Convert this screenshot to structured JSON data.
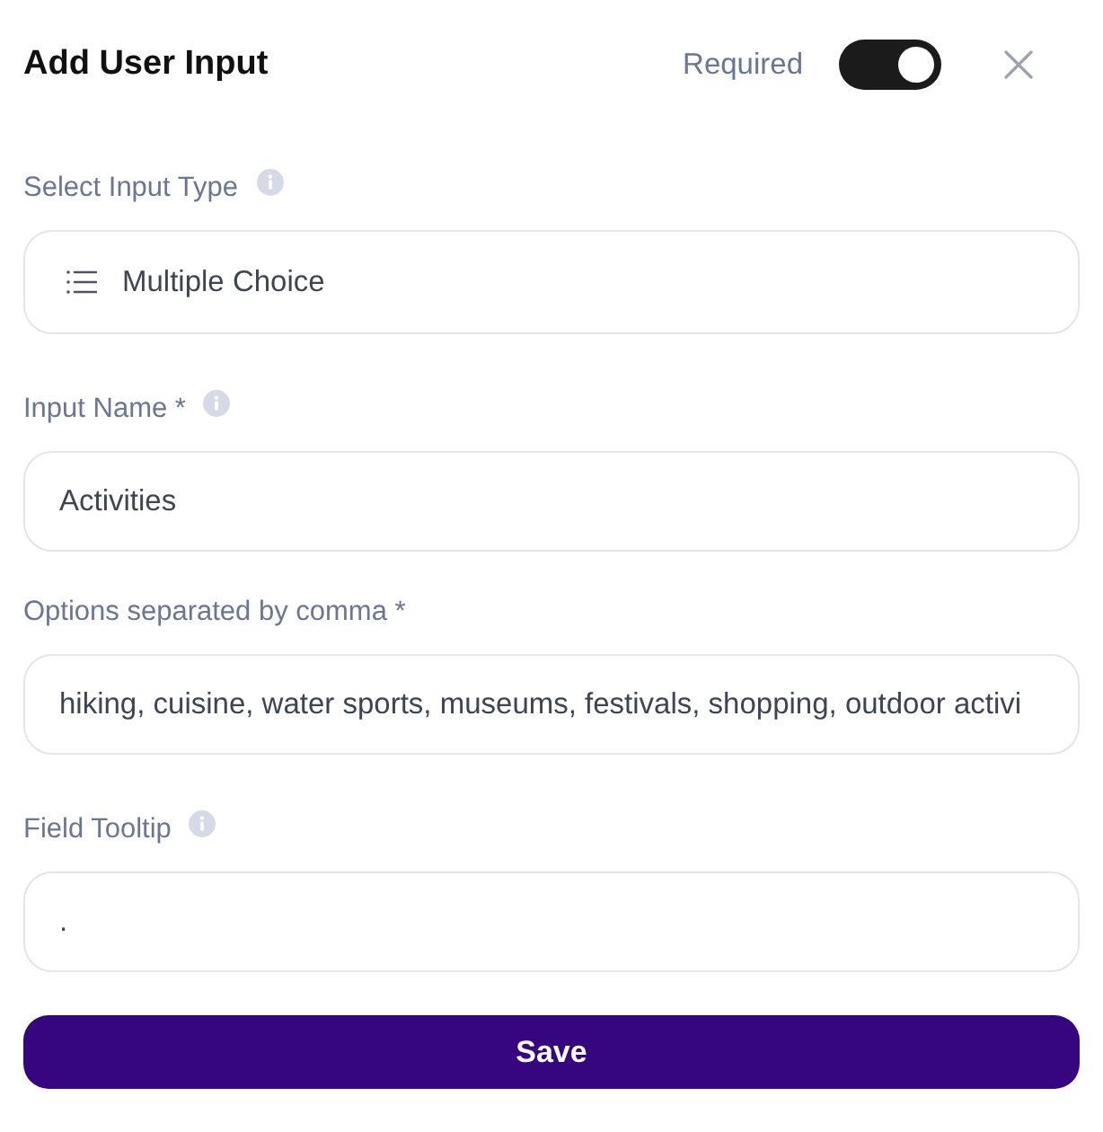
{
  "header": {
    "title": "Add User Input",
    "required": {
      "label": "Required",
      "on": true
    }
  },
  "fields": [
    {
      "kind": "select",
      "label": "Select Input Type",
      "info": true,
      "value": "Multiple Choice"
    },
    {
      "kind": "text",
      "label": "Input Name *",
      "info": true,
      "value": "Activities"
    },
    {
      "kind": "text",
      "label": "Options separated by comma *",
      "info": false,
      "value": "hiking, cuisine, water sports, museums, festivals, shopping, outdoor activi"
    },
    {
      "kind": "text",
      "label": "Field Tooltip",
      "info": true,
      "value": "."
    }
  ],
  "save_button": {
    "label": "Save"
  }
}
